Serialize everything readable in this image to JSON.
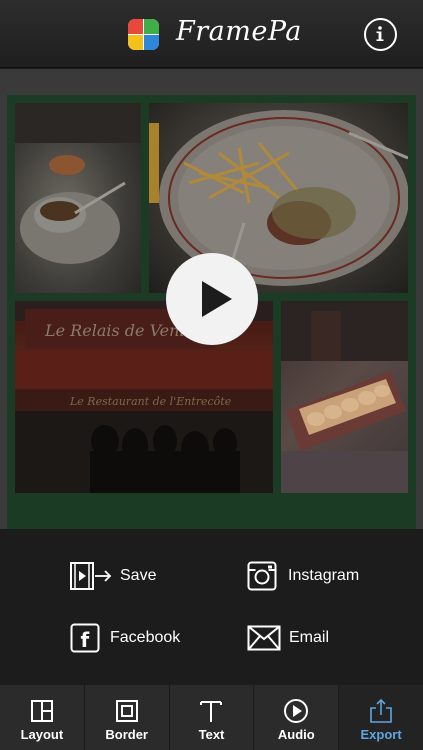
{
  "header": {
    "title": "FramePa",
    "info_icon": "info-icon",
    "logo_colors": [
      "#e8483b",
      "#3fae49",
      "#f3c21a",
      "#2f87d9"
    ]
  },
  "preview": {
    "frame_color": "#1c3b25",
    "play_icon": "play-icon"
  },
  "share": {
    "save_label": "Save",
    "instagram_label": "Instagram",
    "facebook_label": "Facebook",
    "email_label": "Email"
  },
  "tabs": [
    {
      "label": "Layout",
      "icon": "layout-icon",
      "active": false
    },
    {
      "label": "Border",
      "icon": "border-icon",
      "active": false
    },
    {
      "label": "Text",
      "icon": "text-icon",
      "active": false
    },
    {
      "label": "Audio",
      "icon": "audio-icon",
      "active": false
    },
    {
      "label": "Export",
      "icon": "export-icon",
      "active": true
    }
  ],
  "colors": {
    "active_tab": "#5ea6e0",
    "tabbar_bg": "#2b2b2b",
    "background": "#1c1c1c"
  }
}
